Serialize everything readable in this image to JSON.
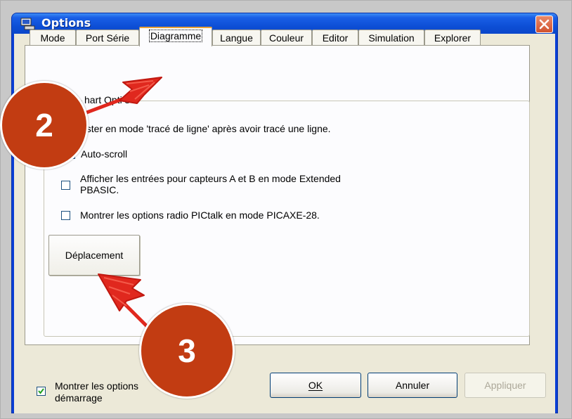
{
  "window": {
    "title": "Options"
  },
  "tabs": [
    {
      "label": "Mode",
      "active": false
    },
    {
      "label": "Port Série",
      "active": false
    },
    {
      "label": "Diagramme",
      "active": true
    },
    {
      "label": "Langue",
      "active": false
    },
    {
      "label": "Couleur",
      "active": false
    },
    {
      "label": "Editor",
      "active": false
    },
    {
      "label": "Simulation",
      "active": false
    },
    {
      "label": "Explorer",
      "active": false
    }
  ],
  "group": {
    "label": "hart Opti      s"
  },
  "options": [
    {
      "label": "ester en mode 'tracé de ligne' après avoir tracé une ligne.",
      "checked": false
    },
    {
      "label": "Auto-scroll",
      "checked": false
    },
    {
      "label_line1": "Afficher les entrées pour capteurs A et B en mode Extended",
      "label_line2": "PBASIC.",
      "checked": false
    },
    {
      "label": "Montrer les options radio PICtalk en mode PICAXE-28.",
      "checked": false
    }
  ],
  "deplacement_button": "Déplacement",
  "footer": {
    "startup_check_line1": "Montrer les options",
    "startup_check_line2": "démarrage",
    "startup_checked": true,
    "ok_label": "OK",
    "cancel_label": "Annuler",
    "apply_label": "Appliquer"
  },
  "annotations": [
    {
      "label": "2"
    },
    {
      "label": "3"
    }
  ],
  "colors": {
    "titlebar": "#0d4fd6",
    "badge": "#c23c12",
    "arrow": "#e0281e",
    "dialog_bg": "#ece9d8"
  }
}
